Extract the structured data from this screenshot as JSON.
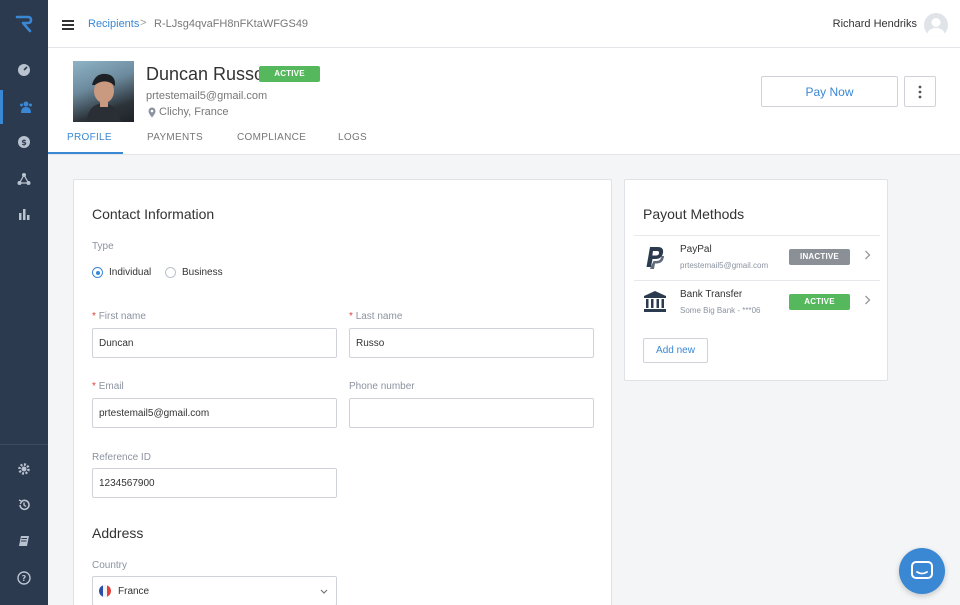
{
  "breadcrumb": {
    "parent": "Recipients",
    "separator": ">",
    "current": "R-LJsg4qvaFH8nFKtaWFGS49"
  },
  "user": {
    "name": "Richard Hendriks"
  },
  "recipient": {
    "name": "Duncan Russo",
    "status": "ACTIVE",
    "email": "prtestemail5@gmail.com",
    "location": "Clichy, France"
  },
  "actions": {
    "pay_now": "Pay Now"
  },
  "tabs": [
    {
      "label": "PROFILE",
      "active": true
    },
    {
      "label": "PAYMENTS",
      "active": false
    },
    {
      "label": "COMPLIANCE",
      "active": false
    },
    {
      "label": "LOGS",
      "active": false
    }
  ],
  "contact": {
    "title": "Contact Information",
    "type_label": "Type",
    "type_options": [
      "Individual",
      "Business"
    ],
    "type_selected": "Individual",
    "first_name_label": "First name",
    "first_name_value": "Duncan",
    "last_name_label": "Last name",
    "last_name_value": "Russo",
    "email_label": "Email",
    "email_value": "prtestemail5@gmail.com",
    "phone_label": "Phone number",
    "phone_value": "",
    "reference_label": "Reference ID",
    "reference_value": "1234567900",
    "required_mark": "*"
  },
  "address": {
    "title": "Address",
    "country_label": "Country",
    "country_value": "France"
  },
  "payout": {
    "title": "Payout Methods",
    "methods": [
      {
        "name": "PayPal",
        "detail": "prtestemail5@gmail.com",
        "status": "INACTIVE",
        "icon": "paypal-icon"
      },
      {
        "name": "Bank Transfer",
        "detail": "Some Big Bank - ***06",
        "status": "ACTIVE",
        "icon": "bank-icon"
      }
    ],
    "add_label": "Add new"
  },
  "colors": {
    "accent": "#3a87d4",
    "sidebar": "#2c3a50",
    "active_badge": "#56b85c",
    "inactive_badge": "#8b9097"
  }
}
